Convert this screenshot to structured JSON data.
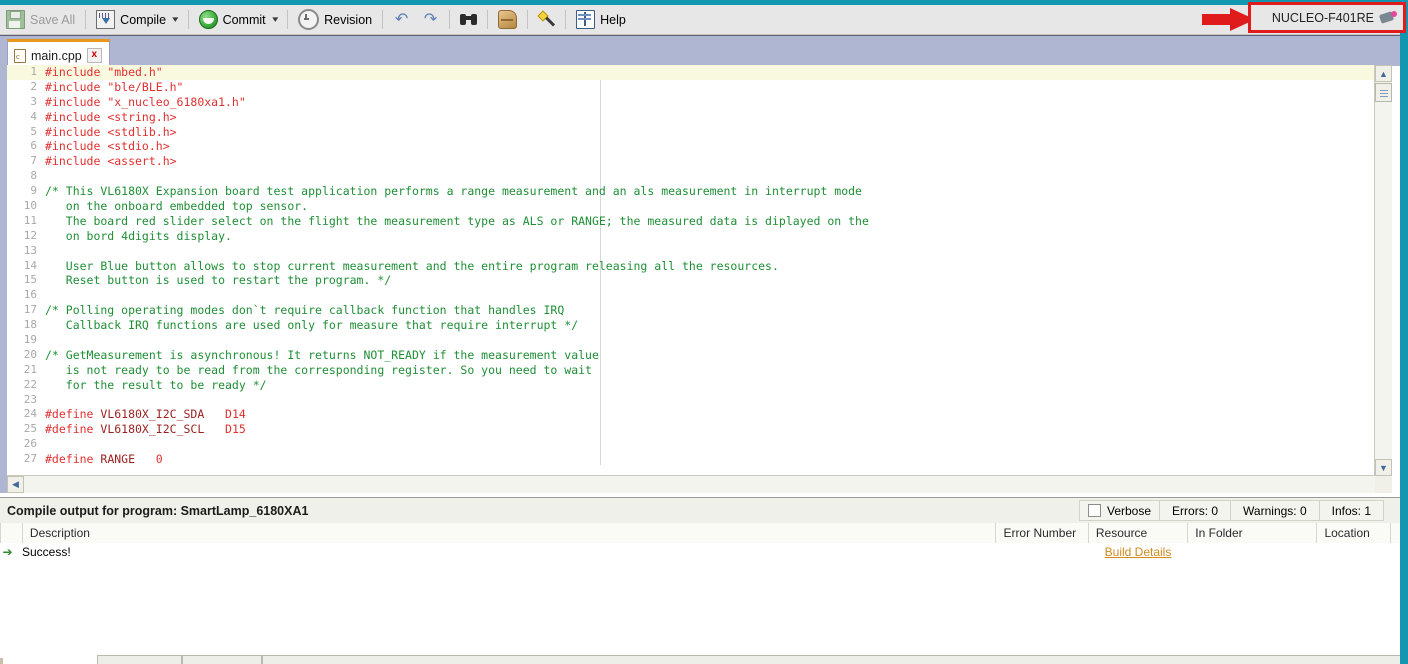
{
  "window": {
    "accent_teal": "#1396b0",
    "highlight_red": "#e01b1b"
  },
  "toolbar": {
    "items": [
      {
        "label": "Save All",
        "icon": "save-all-icon",
        "disabled": true,
        "caret": false
      },
      {
        "label": "Compile",
        "icon": "compile-icon",
        "disabled": false,
        "caret": true
      },
      {
        "label": "Commit",
        "icon": "commit-icon",
        "disabled": false,
        "caret": true
      },
      {
        "label": "Revision",
        "icon": "revision-icon",
        "disabled": false,
        "caret": false
      }
    ],
    "undo_label": "↶",
    "redo_label": "↷",
    "help_label": "Help"
  },
  "platform": {
    "name": "NUCLEO-F401RE",
    "icon": "board-icon",
    "pointer": "red-arrow-annotation"
  },
  "tabs": [
    {
      "label": "main.cpp",
      "close_label": "x",
      "active": true
    }
  ],
  "editor": {
    "lines": [
      {
        "n": 1,
        "highlighted": true,
        "segments": [
          {
            "t": "#include ",
            "c": "pre"
          },
          {
            "t": "\"mbed.h\"",
            "c": "str"
          }
        ]
      },
      {
        "n": 2,
        "highlighted": false,
        "segments": [
          {
            "t": "#include ",
            "c": "pre"
          },
          {
            "t": "\"ble/BLE.h\"",
            "c": "str"
          }
        ]
      },
      {
        "n": 3,
        "highlighted": false,
        "segments": [
          {
            "t": "#include ",
            "c": "pre"
          },
          {
            "t": "\"x_nucleo_6180xa1.h\"",
            "c": "str"
          }
        ]
      },
      {
        "n": 4,
        "highlighted": false,
        "segments": [
          {
            "t": "#include ",
            "c": "pre"
          },
          {
            "t": "<string.h>",
            "c": "str"
          }
        ]
      },
      {
        "n": 5,
        "highlighted": false,
        "segments": [
          {
            "t": "#include ",
            "c": "pre"
          },
          {
            "t": "<stdlib.h>",
            "c": "str"
          }
        ]
      },
      {
        "n": 6,
        "highlighted": false,
        "segments": [
          {
            "t": "#include ",
            "c": "pre"
          },
          {
            "t": "<stdio.h>",
            "c": "str"
          }
        ]
      },
      {
        "n": 7,
        "highlighted": false,
        "segments": [
          {
            "t": "#include ",
            "c": "pre"
          },
          {
            "t": "<assert.h>",
            "c": "str"
          }
        ]
      },
      {
        "n": 8,
        "highlighted": false,
        "segments": []
      },
      {
        "n": 9,
        "highlighted": false,
        "segments": [
          {
            "t": "/* This VL6180X Expansion board test application performs a range measurement and an als measurement in interrupt mode",
            "c": "cmt"
          }
        ]
      },
      {
        "n": 10,
        "highlighted": false,
        "segments": [
          {
            "t": "   on the onboard embedded top sensor.",
            "c": "cmt"
          }
        ]
      },
      {
        "n": 11,
        "highlighted": false,
        "segments": [
          {
            "t": "   The board red slider select on the flight the measurement type as ALS or RANGE; the measured data is diplayed on the",
            "c": "cmt"
          }
        ]
      },
      {
        "n": 12,
        "highlighted": false,
        "segments": [
          {
            "t": "   on bord 4digits display.",
            "c": "cmt"
          }
        ]
      },
      {
        "n": 13,
        "highlighted": false,
        "segments": []
      },
      {
        "n": 14,
        "highlighted": false,
        "segments": [
          {
            "t": "   User Blue button allows to stop current measurement and the entire program releasing all the resources.",
            "c": "cmt"
          }
        ]
      },
      {
        "n": 15,
        "highlighted": false,
        "segments": [
          {
            "t": "   Reset button is used to restart the program. */",
            "c": "cmt"
          }
        ]
      },
      {
        "n": 16,
        "highlighted": false,
        "segments": []
      },
      {
        "n": 17,
        "highlighted": false,
        "segments": [
          {
            "t": "/* Polling operating modes don`t require callback function that handles IRQ",
            "c": "cmt"
          }
        ]
      },
      {
        "n": 18,
        "highlighted": false,
        "segments": [
          {
            "t": "   Callback IRQ functions are used only for measure that require interrupt */",
            "c": "cmt"
          }
        ]
      },
      {
        "n": 19,
        "highlighted": false,
        "segments": []
      },
      {
        "n": 20,
        "highlighted": false,
        "segments": [
          {
            "t": "/* GetMeasurement is asynchronous! It returns NOT_READY if the measurement value",
            "c": "cmt"
          }
        ]
      },
      {
        "n": 21,
        "highlighted": false,
        "segments": [
          {
            "t": "   is not ready to be read from the corresponding register. So you need to wait",
            "c": "cmt"
          }
        ]
      },
      {
        "n": 22,
        "highlighted": false,
        "segments": [
          {
            "t": "   for the result to be ready */",
            "c": "cmt"
          }
        ]
      },
      {
        "n": 23,
        "highlighted": false,
        "segments": []
      },
      {
        "n": 24,
        "highlighted": false,
        "segments": [
          {
            "t": "#define ",
            "c": "pre"
          },
          {
            "t": "VL6180X_I2C_SDA",
            "c": "macro"
          },
          {
            "t": "   ",
            "c": "plain"
          },
          {
            "t": "D14",
            "c": "num"
          }
        ]
      },
      {
        "n": 25,
        "highlighted": false,
        "segments": [
          {
            "t": "#define ",
            "c": "pre"
          },
          {
            "t": "VL6180X_I2C_SCL",
            "c": "macro"
          },
          {
            "t": "   ",
            "c": "plain"
          },
          {
            "t": "D15",
            "c": "num"
          }
        ]
      },
      {
        "n": 26,
        "highlighted": false,
        "segments": []
      },
      {
        "n": 27,
        "highlighted": false,
        "segments": [
          {
            "t": "#define ",
            "c": "pre"
          },
          {
            "t": "RANGE",
            "c": "macro"
          },
          {
            "t": "   ",
            "c": "plain"
          },
          {
            "t": "0",
            "c": "num"
          }
        ]
      }
    ]
  },
  "output": {
    "title": "Compile output for program: SmartLamp_6180XA1",
    "verbose_label": "Verbose",
    "verbose_checked": false,
    "counters": [
      {
        "label": "Errors: 0"
      },
      {
        "label": "Warnings: 0"
      },
      {
        "label": "Infos: 1"
      }
    ],
    "columns": [
      {
        "label": "Description"
      },
      {
        "label": "Error Number"
      },
      {
        "label": "Resource"
      },
      {
        "label": "In Folder"
      },
      {
        "label": "Location"
      }
    ],
    "rows": [
      {
        "status_icon": "green-arrow-icon",
        "description": "Success!",
        "error_number": "",
        "resource": "Build Details",
        "resource_is_link": true,
        "in_folder": "",
        "location": ""
      }
    ]
  }
}
